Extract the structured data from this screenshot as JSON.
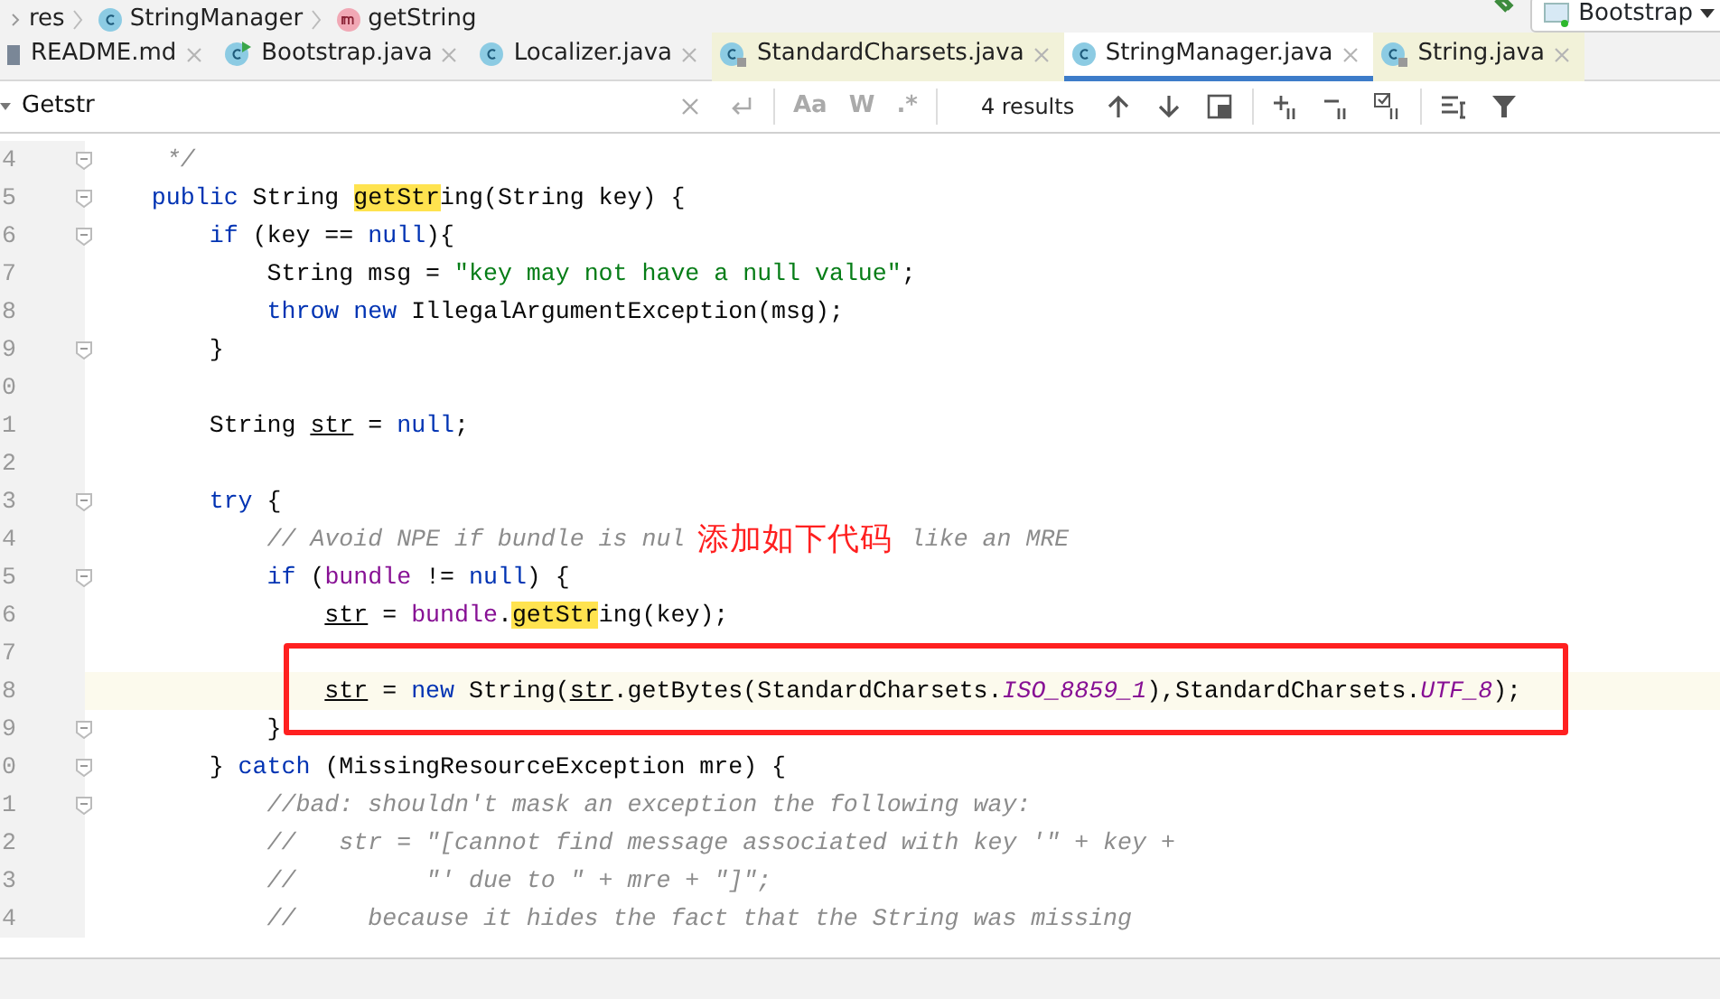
{
  "breadcrumb": [
    {
      "label": "res",
      "kind": "folder"
    },
    {
      "label": "StringManager",
      "kind": "class"
    },
    {
      "label": "getString",
      "kind": "method"
    }
  ],
  "run_config": {
    "label": "Bootstrap"
  },
  "tabs": [
    {
      "label": "README.md",
      "kind": "file",
      "selected": false,
      "library": false
    },
    {
      "label": "Bootstrap.java",
      "kind": "runnable",
      "selected": false,
      "library": false
    },
    {
      "label": "Localizer.java",
      "kind": "class",
      "selected": false,
      "library": false
    },
    {
      "label": "StandardCharsets.java",
      "kind": "locked",
      "selected": false,
      "library": true
    },
    {
      "label": "StringManager.java",
      "kind": "class",
      "selected": true,
      "library": false
    },
    {
      "label": "String.java",
      "kind": "locked",
      "selected": false,
      "library": true
    }
  ],
  "search": {
    "value": "Getstr",
    "match_case": "Aa",
    "words": "W",
    "regex": ".*",
    "results": "4 results"
  },
  "lines": [
    {
      "number": "4",
      "fold": true,
      "current": false,
      "tokens": [
        {
          "text": "     */",
          "kind": "comment"
        }
      ]
    },
    {
      "number": "5",
      "fold": true,
      "current": false,
      "tokens": [
        {
          "text": "    public ",
          "kind": "keyword"
        },
        {
          "text": "String "
        },
        {
          "text": "getStr",
          "kind": "match"
        },
        {
          "text": "ing(String key) {"
        }
      ]
    },
    {
      "number": "6",
      "fold": true,
      "current": false,
      "tokens": [
        {
          "text": "        if ",
          "kind": "keyword"
        },
        {
          "text": "(key == "
        },
        {
          "text": "null",
          "kind": "keyword"
        },
        {
          "text": "){"
        }
      ]
    },
    {
      "number": "7",
      "fold": false,
      "current": false,
      "tokens": [
        {
          "text": "            String msg = "
        },
        {
          "text": "\"key may not have a null value\"",
          "kind": "string"
        },
        {
          "text": ";"
        }
      ]
    },
    {
      "number": "8",
      "fold": false,
      "current": false,
      "tokens": [
        {
          "text": "            throw new ",
          "kind": "keyword"
        },
        {
          "text": "IllegalArgumentException(msg);"
        }
      ]
    },
    {
      "number": "9",
      "fold": true,
      "current": false,
      "tokens": [
        {
          "text": "        }"
        }
      ]
    },
    {
      "number": "0",
      "fold": false,
      "current": false
    },
    {
      "number": "1",
      "fold": false,
      "current": false,
      "tokens": [
        {
          "text": "        String "
        },
        {
          "text": "str",
          "kind": "local"
        },
        {
          "text": " = "
        },
        {
          "text": "null",
          "kind": "keyword"
        },
        {
          "text": ";"
        }
      ]
    },
    {
      "number": "2",
      "fold": false,
      "current": false
    },
    {
      "number": "3",
      "fold": true,
      "current": false,
      "tokens": [
        {
          "text": "        try ",
          "kind": "keyword"
        },
        {
          "text": "{"
        }
      ]
    },
    {
      "number": "4",
      "fold": false,
      "current": false,
      "tokens": [
        {
          "text": "            // Avoid NPE if bundle is nul",
          "kind": "comment"
        },
        {
          "text": "               like an MRE",
          "kind": "comment",
          "gap": true
        }
      ]
    },
    {
      "number": "5",
      "fold": true,
      "current": false,
      "tokens": [
        {
          "text": "            if ",
          "kind": "keyword"
        },
        {
          "text": "("
        },
        {
          "text": "bundle",
          "kind": "field"
        },
        {
          "text": " != "
        },
        {
          "text": "null",
          "kind": "keyword"
        },
        {
          "text": ") {"
        }
      ]
    },
    {
      "number": "6",
      "fold": false,
      "current": false,
      "tokens": [
        {
          "text": "                str",
          "kind": "local"
        },
        {
          "text": " = "
        },
        {
          "text": "bundle",
          "kind": "field"
        },
        {
          "text": "."
        },
        {
          "text": "getStr",
          "kind": "match"
        },
        {
          "text": "ing(key);"
        }
      ]
    },
    {
      "number": "7",
      "fold": false,
      "current": false
    },
    {
      "number": "8",
      "fold": false,
      "current": true,
      "tokens": [
        {
          "text": "                str",
          "kind": "local"
        },
        {
          "text": " = "
        },
        {
          "text": "new ",
          "kind": "keyword"
        },
        {
          "text": "String("
        },
        {
          "text": "str",
          "kind": "local"
        },
        {
          "text": ".getBytes(StandardCharsets."
        },
        {
          "text": "ISO_8859_1",
          "kind": "constant"
        },
        {
          "text": "),StandardCharsets."
        },
        {
          "text": "UTF_8",
          "kind": "constant"
        },
        {
          "text": ");"
        }
      ]
    },
    {
      "number": "9",
      "fold": true,
      "current": false,
      "tokens": [
        {
          "text": "            }"
        }
      ]
    },
    {
      "number": "0",
      "fold": true,
      "current": false,
      "tokens": [
        {
          "text": "        } "
        },
        {
          "text": "catch ",
          "kind": "keyword"
        },
        {
          "text": "(MissingResourceException mre) {"
        }
      ]
    },
    {
      "number": "1",
      "fold": true,
      "current": false,
      "tokens": [
        {
          "text": "            //bad: shouldn't mask an exception the following way:",
          "kind": "comment"
        }
      ]
    },
    {
      "number": "2",
      "fold": false,
      "current": false,
      "tokens": [
        {
          "text": "            //   str = \"[cannot find message associated with key '\" + key +",
          "kind": "comment"
        }
      ]
    },
    {
      "number": "3",
      "fold": false,
      "current": false,
      "tokens": [
        {
          "text": "            //         \"' due to \" + mre + \"]\";",
          "kind": "comment"
        }
      ]
    },
    {
      "number": "4",
      "fold": false,
      "current": false,
      "tokens": [
        {
          "text": "            //     because it hides the fact that the String was missing",
          "kind": "comment"
        }
      ]
    }
  ],
  "annotation": {
    "text": "添加如下代码",
    "color": "#ff2020"
  }
}
